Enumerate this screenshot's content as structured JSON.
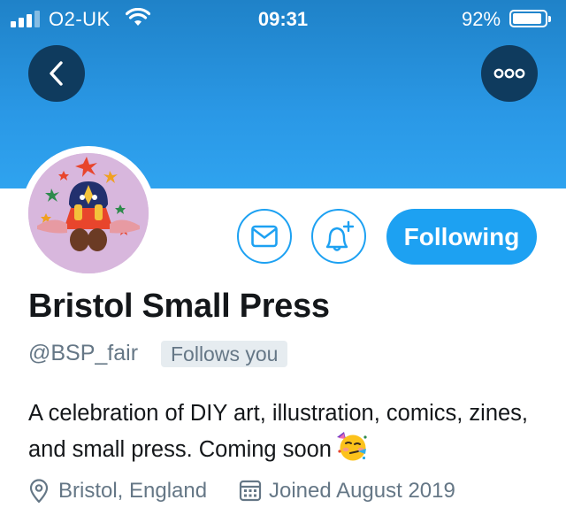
{
  "status_bar": {
    "carrier": "O2-UK",
    "time": "09:31",
    "battery_percent": "92%",
    "battery_level": 0.92,
    "icons": [
      "signal-icon",
      "wifi-icon",
      "battery-icon"
    ]
  },
  "header": {
    "back_icon": "chevron-left-icon",
    "more_icon": "more-dots-icon"
  },
  "actions": {
    "message_icon": "envelope-icon",
    "notify_icon": "bell-plus-icon",
    "following_label": "Following"
  },
  "profile": {
    "display_name": "Bristol Small Press",
    "handle": "@BSP_fair",
    "follows_you": "Follows you",
    "bio": "A celebration of DIY art, illustration, comics, zines, and small press. Coming soon",
    "bio_emoji": "partying-face-emoji",
    "location": "Bristol, England",
    "joined": "Joined August 2019"
  },
  "colors": {
    "banner": "#2a98e6",
    "accent": "#1da1f2",
    "dark_button": "#0f3b5e",
    "secondary_text": "#657786"
  }
}
